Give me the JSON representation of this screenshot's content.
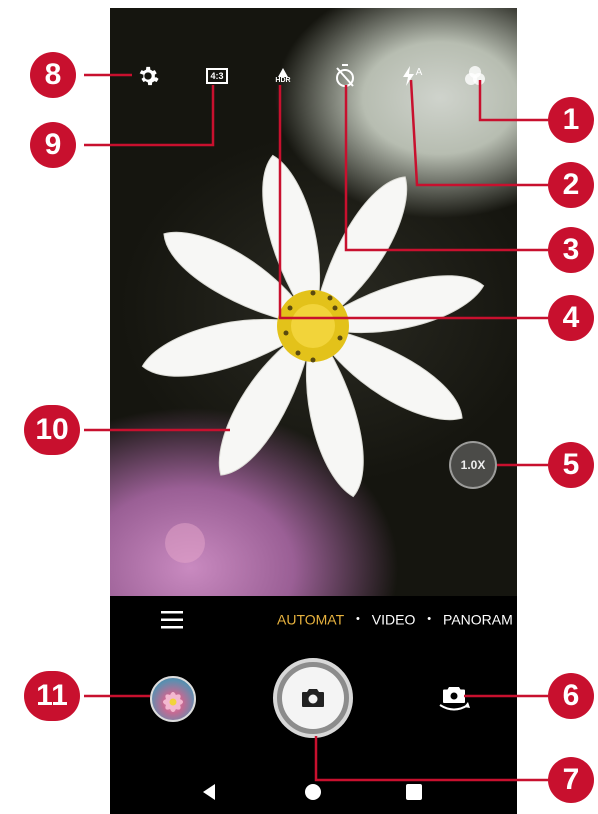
{
  "topbar": {
    "icons": [
      "settings-icon",
      "aspect-ratio-icon",
      "hdr-icon",
      "timer-off-icon",
      "flash-auto-icon",
      "filter-icon"
    ],
    "aspect_ratio_label": "4:3",
    "hdr_label": "HDR",
    "flash_label": "A"
  },
  "zoom": {
    "label": "1.0X"
  },
  "modes": {
    "active": "AUTOMAT",
    "items": [
      "AUTOMAT",
      "VIDEO",
      "PANORAM"
    ],
    "separator": "•"
  },
  "callouts": [
    "1",
    "2",
    "3",
    "4",
    "5",
    "6",
    "7",
    "8",
    "9",
    "10",
    "11"
  ],
  "colors": {
    "callout": "#c8102e",
    "active_mode": "#e7b23e"
  }
}
